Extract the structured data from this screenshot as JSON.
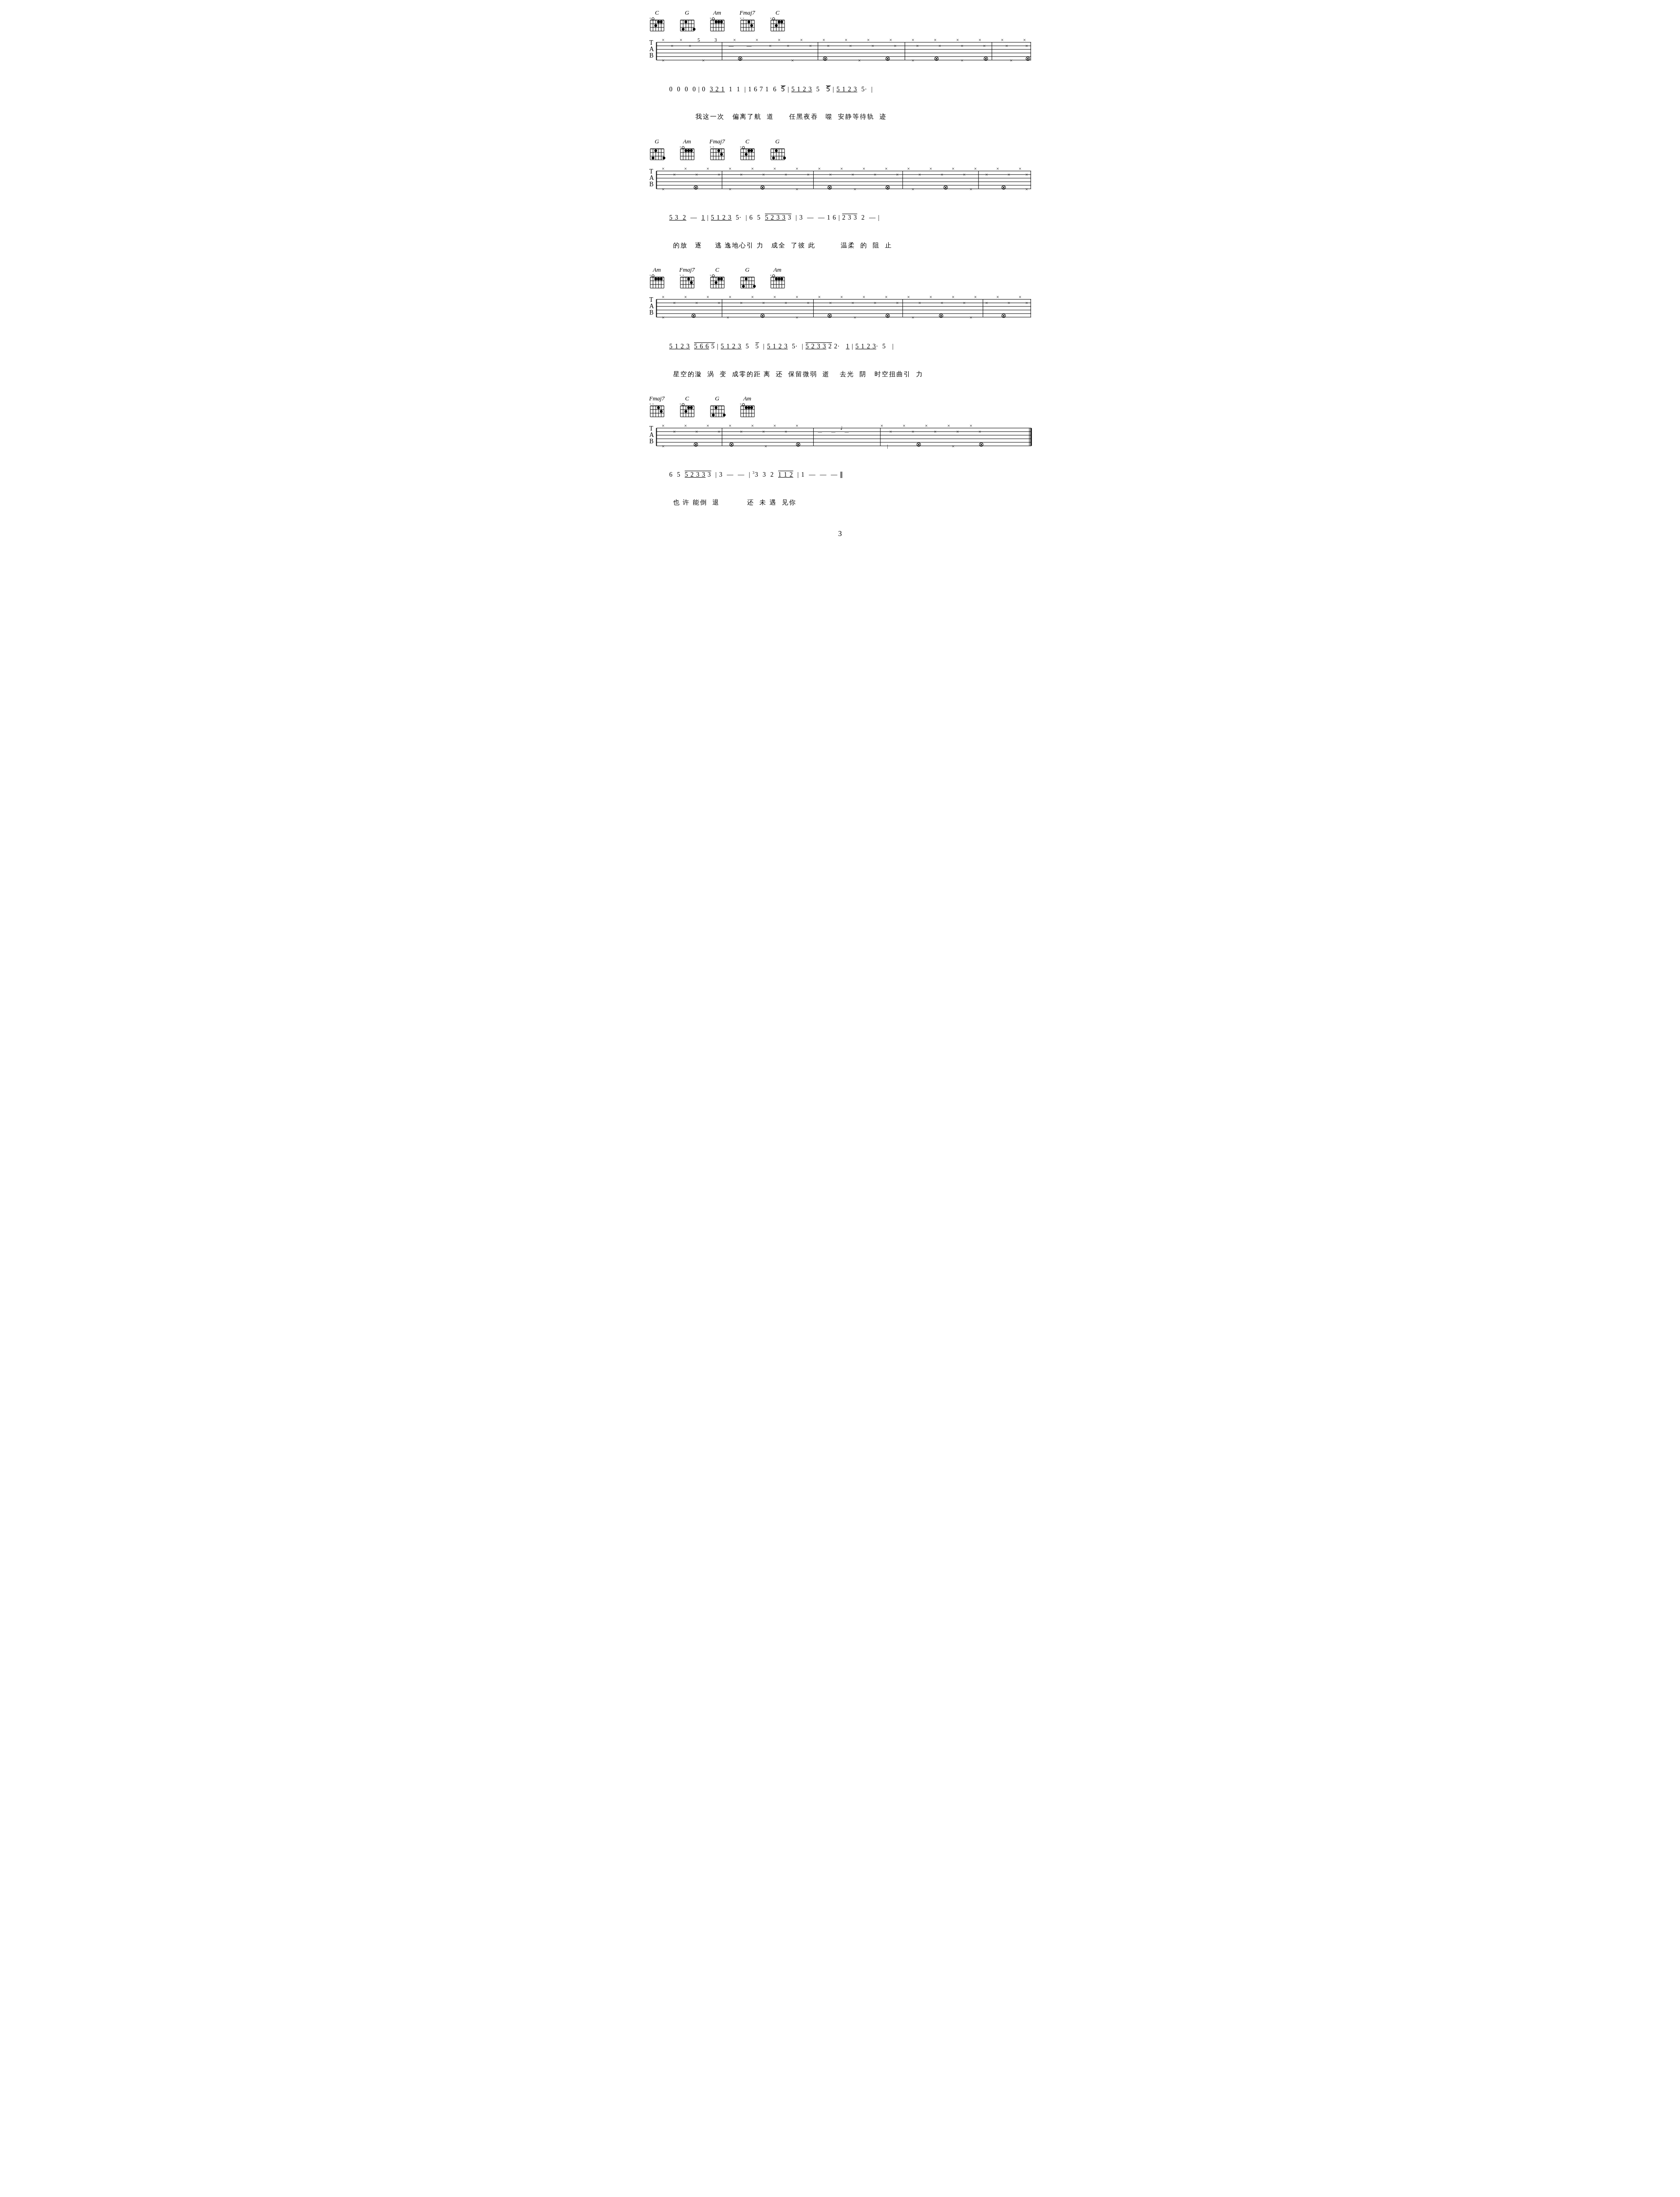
{
  "page": {
    "number": "3",
    "sections": [
      {
        "id": "section1",
        "chords": [
          "C",
          "G",
          "Am",
          "Fmaj7",
          "C"
        ],
        "notation": "0  0  0  0 | 0  <u>3 2 1</u> 1  1  | 1 6 7 1  6  <o>5</o> | <u>5 1 2 3</u>  5   <o>5</o> | <u>5 1 2 3</u>  5·  |",
        "lyrics": "         我这一次   偏离了航  道      任黑夜吞   噬  安静等待轨  迹"
      },
      {
        "id": "section2",
        "chords": [
          "G",
          "Am",
          "Fmaj7",
          "C",
          "G"
        ],
        "notation": "<u>5 3  2</u>  —  <u>1</u> | <u>5 1 2 3</u>  5·  | 6  5  <o><u>5 2 3 3</u> 3</o>  | 3  —  — 1 6 | <o>2 3 3</o>  2  — |",
        "lyrics": "的放   逐     逃 逸地心引 力   成全  了彼 此          温柔  的  阻  止"
      },
      {
        "id": "section3",
        "chords": [
          "Am",
          "Fmaj7",
          "C",
          "G",
          "Am"
        ],
        "notation": "<u>5 1 2 3</u>  <o><u>5 6 6</u> 5</o> | <u>5 1 2 3</u>  5   <o>5</o> | <u>5 1 2 3</u>  5·  | <o><u>5 2 3 3</u> 2</o> 2·   <u>1</u> | <u>5 1 2 3</u>·  5   |",
        "lyrics": "星空的漩  涡  变  成零的距 离  还  保留微弱  逝    去光  阴   时空扭曲引  力"
      },
      {
        "id": "section4",
        "chords": [
          "Fmaj7",
          "C",
          "G",
          "Am"
        ],
        "notation": "6  5  <o><u>5 2 3 3</u> 3</o>  | 3  —  —  | <sup>3</sup>3  3  2  <o><u>1 1 2</u></o>  | 1  —  —  — ‖",
        "lyrics": "也 许 能倒  退          还  未 遇  见你"
      }
    ]
  }
}
